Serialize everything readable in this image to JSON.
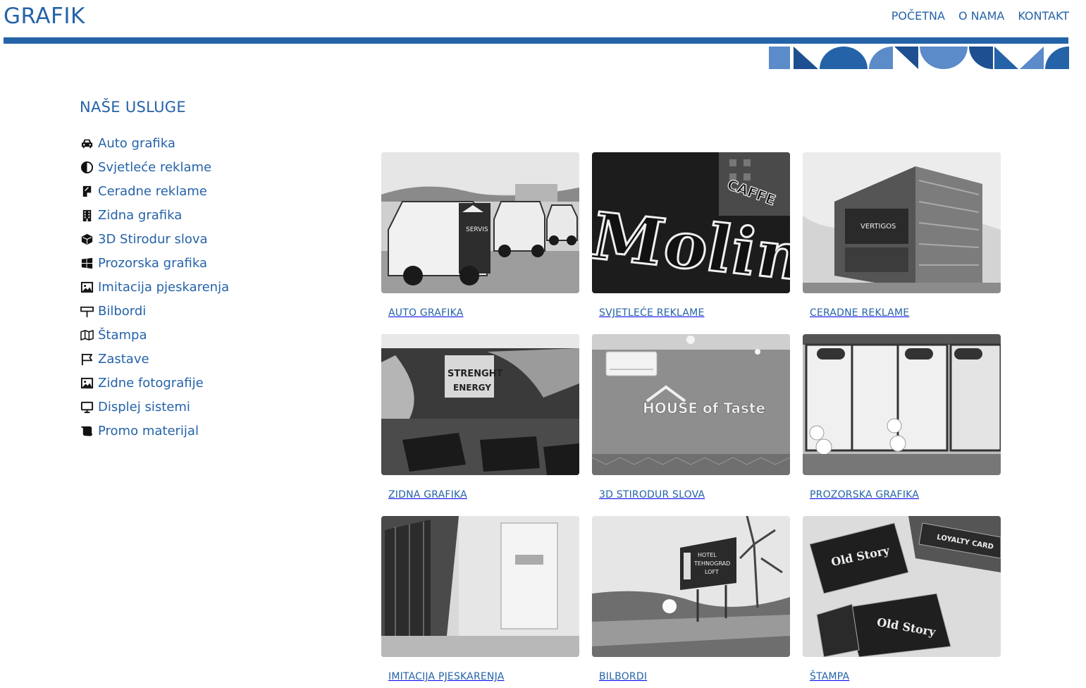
{
  "brand": {
    "logo": "GRAFIK",
    "accent": "#2563a8",
    "shape_light": "#5b8bc9",
    "shape_dark": "#1d4f91"
  },
  "nav": [
    {
      "label": "POČETNA"
    },
    {
      "label": "O NAMA"
    },
    {
      "label": "KONTAKT"
    }
  ],
  "sidebar": {
    "title": "NAŠE USLUGE",
    "items": [
      {
        "label": "Auto grafika",
        "icon": "car-icon"
      },
      {
        "label": "Svjetleće reklame",
        "icon": "contrast-icon"
      },
      {
        "label": "Ceradne reklame",
        "icon": "sticky-note-icon"
      },
      {
        "label": "Zidna grafika",
        "icon": "building-icon"
      },
      {
        "label": "3D Stirodur slova",
        "icon": "cube-icon"
      },
      {
        "label": "Prozorska grafika",
        "icon": "windows-icon"
      },
      {
        "label": "Imitacija pjeskarenja",
        "icon": "image-icon"
      },
      {
        "label": "Bilbordi",
        "icon": "billboard-icon"
      },
      {
        "label": "Štampa",
        "icon": "map-icon"
      },
      {
        "label": "Zastave",
        "icon": "flag-icon"
      },
      {
        "label": "Zidne fotografije",
        "icon": "image-icon"
      },
      {
        "label": "Displej sistemi",
        "icon": "monitor-icon"
      },
      {
        "label": "Promo materijal",
        "icon": "scroll-icon"
      }
    ]
  },
  "gallery": [
    {
      "caption": "AUTO GRAFIKA",
      "photo": "vans-photo"
    },
    {
      "caption": "SVJETLEĆE REKLAME",
      "photo": "neon-sign-photo"
    },
    {
      "caption": "CERADNE REKLAME",
      "photo": "hotel-building-photo"
    },
    {
      "caption": "ZIDNA GRAFIKA",
      "photo": "gym-wall-photo"
    },
    {
      "caption": "3D STIRODUR SLOVA",
      "photo": "house-of-taste-photo"
    },
    {
      "caption": "PROZORSKA GRAFIKA",
      "photo": "shop-window-photo"
    },
    {
      "caption": "IMITACIJA PJESKARENJA",
      "photo": "frosted-glass-photo"
    },
    {
      "caption": "BILBORDI",
      "photo": "roadside-billboard-photo"
    },
    {
      "caption": "ŠTAMPA",
      "photo": "loyalty-cards-photo"
    }
  ],
  "photo_text": {
    "van": "SERVIS",
    "neon_main": "Molinari",
    "neon_small": "CAFFE",
    "hotel": "VERTIGOS",
    "gym_1": "STRENGHT",
    "gym_2": "ENERGY",
    "taste": "HOUSE of Taste",
    "billboard_1": "HOTEL",
    "billboard_2": "TEHNOGRAD",
    "billboard_3": "LOFT",
    "card_top": "LOYALTY CARD",
    "card_1": "Old Story",
    "card_2": "Old Story"
  }
}
